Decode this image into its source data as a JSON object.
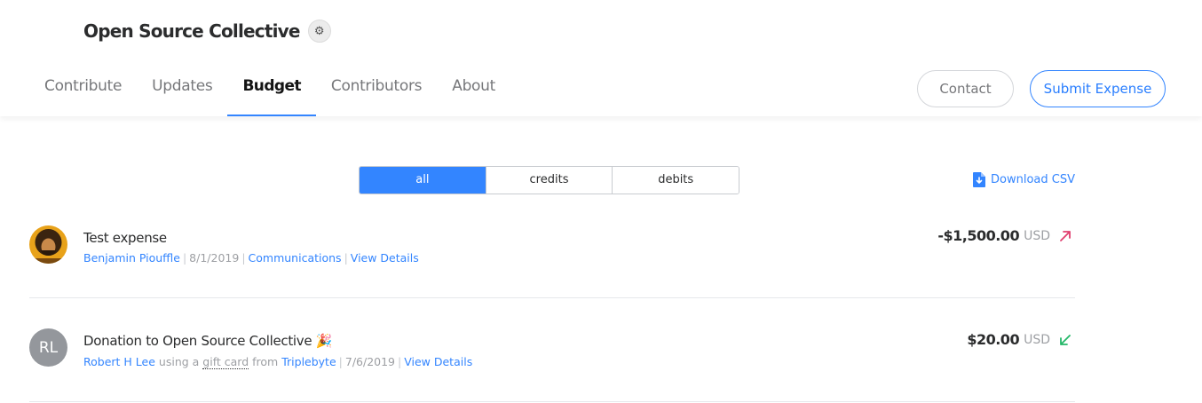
{
  "collective": {
    "name": "Open Source Collective",
    "settings_icon": "gear-icon"
  },
  "nav": {
    "tabs": [
      {
        "label": "Contribute",
        "active": false
      },
      {
        "label": "Updates",
        "active": false
      },
      {
        "label": "Budget",
        "active": true
      },
      {
        "label": "Contributors",
        "active": false
      },
      {
        "label": "About",
        "active": false
      }
    ],
    "contact_label": "Contact",
    "submit_expense_label": "Submit Expense"
  },
  "filter": {
    "options": [
      "all",
      "credits",
      "debits"
    ],
    "selected": "all"
  },
  "download": {
    "label": "Download CSV",
    "icon": "file-download-icon"
  },
  "transactions": [
    {
      "description": "Test expense",
      "avatar": "photo",
      "user": "Benjamin Piouffle",
      "date": "8/1/2019",
      "category": "Communications",
      "details_label": "View Details",
      "amount": "-$1,500.00",
      "currency": "USD",
      "direction": "debit",
      "arrow_color": "#e03f6f"
    },
    {
      "description": "Donation to Open Source Collective 🎉",
      "avatar_initials": "RL",
      "user": "Robert H Lee",
      "using_text": "using a",
      "payment_method": "gift card",
      "from_text": "from",
      "source": "Triplebyte",
      "date": "7/6/2019",
      "details_label": "View Details",
      "amount": "$20.00",
      "currency": "USD",
      "direction": "credit",
      "arrow_color": "#25b869"
    }
  ],
  "colors": {
    "accent": "#3385ff",
    "text": "#313233",
    "muted": "#9d9fa3"
  }
}
